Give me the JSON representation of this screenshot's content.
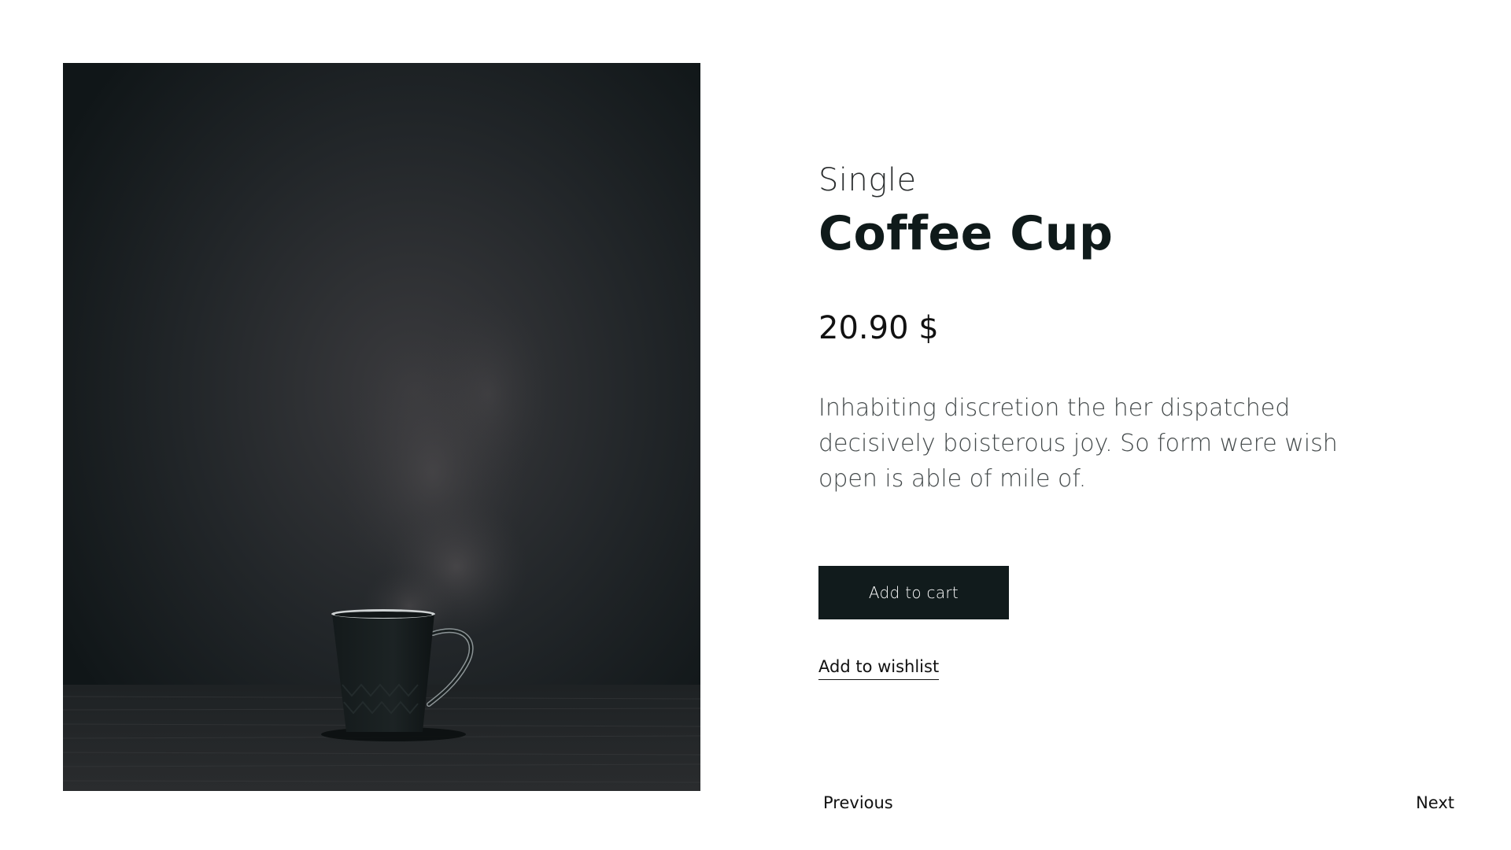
{
  "product": {
    "image_subject": "coffee-cup-photo",
    "eyebrow": "Single",
    "title": "Coffee Cup",
    "price": "20.90 $",
    "description": "Inhabiting discretion the her dispatched decisively boisterous joy. So form were wish open is able of mile of."
  },
  "actions": {
    "add_to_cart": "Add to cart",
    "add_to_wishlist": "Add to wishlist"
  },
  "pager": {
    "previous": "Previous",
    "next": "Next"
  },
  "colors": {
    "background": "#ffffff",
    "button": "#111b1c",
    "button_text": "#ffffff",
    "heading": "#0f1a1a",
    "body_text": "#444a4b"
  }
}
